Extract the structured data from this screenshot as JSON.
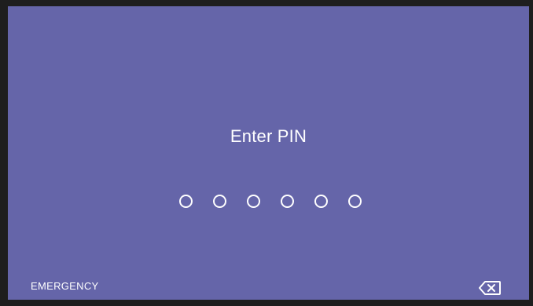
{
  "lock_screen": {
    "title": "Enter PIN",
    "pin_length": 6,
    "pin_filled": 0,
    "emergency_label": "EMERGENCY",
    "backspace_icon": "backspace-icon"
  },
  "colors": {
    "background": "#6565a9",
    "foreground": "#ffffff",
    "frame": "#1e1e1e"
  }
}
